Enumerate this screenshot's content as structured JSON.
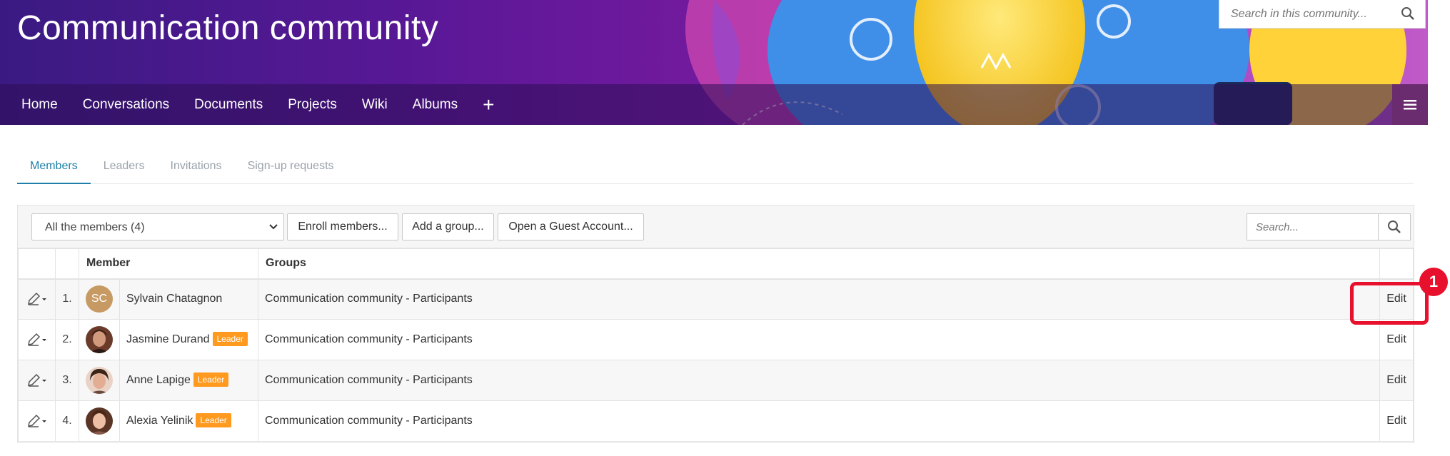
{
  "header": {
    "title": "Communication community",
    "search_placeholder": "Search in this community...",
    "nav": [
      "Home",
      "Conversations",
      "Documents",
      "Projects",
      "Wiki",
      "Albums"
    ],
    "add_icon": "plus-icon",
    "menu_icon": "hamburger-icon"
  },
  "tabs": [
    {
      "label": "Members",
      "active": true
    },
    {
      "label": "Leaders",
      "active": false
    },
    {
      "label": "Invitations",
      "active": false
    },
    {
      "label": "Sign-up requests",
      "active": false
    }
  ],
  "toolbar": {
    "filter_selected": "All the members (4)",
    "enroll_label": "Enroll members...",
    "add_group_label": "Add a group...",
    "guest_label": "Open a Guest Account...",
    "search_placeholder": "Search..."
  },
  "table": {
    "columns": [
      "Member",
      "Groups"
    ],
    "rows": [
      {
        "num": "1.",
        "initials": "SC",
        "name": "Sylvain Chatagnon",
        "leader": "",
        "group": "Communication community - Participants",
        "action": "Edit"
      },
      {
        "num": "2.",
        "initials": "",
        "name": "Jasmine Durand",
        "leader": "Leader",
        "group": "Communication community - Participants",
        "action": "Edit"
      },
      {
        "num": "3.",
        "initials": "",
        "name": "Anne Lapige",
        "leader": "Leader",
        "group": "Communication community - Participants",
        "action": "Edit"
      },
      {
        "num": "4.",
        "initials": "",
        "name": "Alexia Yelinik",
        "leader": "Leader",
        "group": "Communication community - Participants",
        "action": "Edit"
      }
    ]
  },
  "annotation": {
    "badge": "1"
  },
  "colors": {
    "accent": "#1e7fa8",
    "leader": "#ff9a1f",
    "callout": "#e8112d"
  }
}
